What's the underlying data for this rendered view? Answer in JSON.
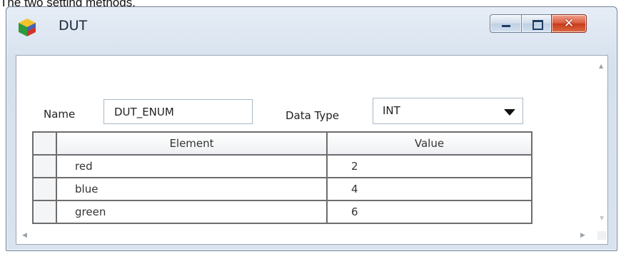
{
  "caption": "The two setting methods.",
  "window": {
    "title": "DUT",
    "controls": {
      "minimize": "minimize",
      "maximize": "maximize",
      "close": "✕"
    }
  },
  "form": {
    "name_label": "Name",
    "name_value": "DUT_ENUM",
    "data_type_label": "Data Type",
    "data_type_value": "INT"
  },
  "table": {
    "headers": {
      "element": "Element",
      "value": "Value"
    },
    "rows": [
      {
        "element": "red",
        "value": "2"
      },
      {
        "element": "blue",
        "value": "4"
      },
      {
        "element": "green",
        "value": "6"
      }
    ]
  },
  "icons": {
    "app": "cube-icon",
    "minimize": "minimize-icon",
    "maximize": "maximize-icon",
    "close": "close-icon",
    "dropdown": "chevron-down-icon"
  },
  "colors": {
    "titlebar": "#d6e1ee",
    "close_button": "#c63a1c",
    "grid_border": "#6d6d6d"
  }
}
